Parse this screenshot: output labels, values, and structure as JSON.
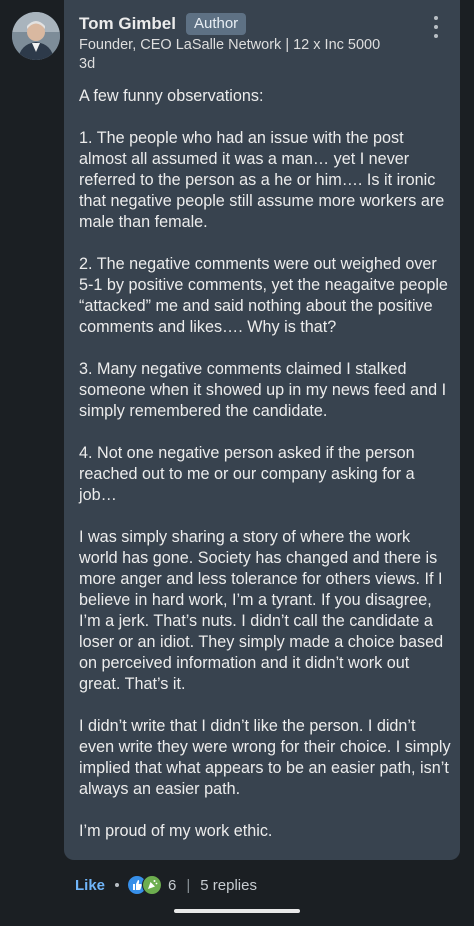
{
  "comment": {
    "author_name": "Tom Gimbel",
    "author_badge": "Author",
    "headline": "Founder, CEO LaSalle Network | 12 x Inc 5000",
    "timestamp": "3d",
    "paragraphs": [
      "A few funny observations:",
      "1. The people who had an issue with the post almost all assumed it was a man… yet I never referred to the person as a he or him…. Is it ironic that negative people still assume more workers are male than female.",
      "2. The negative comments were out weighed over 5-1 by positive comments, yet the neagaitve people “attacked” me and said nothing about the positive comments and likes…. Why is that?",
      "3. Many negative comments claimed I stalked someone when it showed up in my news feed and I simply remembered the candidate.",
      "4. Not one negative person asked if the person reached out to me or our company asking for a job…",
      "I was simply sharing a story of where the work world has gone. Society has changed and there is more anger and less tolerance for others views. If I believe in hard work, I’m a tyrant. If you disagree, I’m a jerk. That’s nuts. I didn’t call the candidate a loser or an idiot. They simply made a choice based on perceived information and it didn’t work out great. That’s it.",
      "I didn’t write that I didn’t like the person. I didn’t even write they were wrong for their choice. I simply implied that what appears to be an easier path, isn’t always an easier path.",
      "I’m proud of my work ethic."
    ]
  },
  "actions": {
    "like_label": "Like",
    "reaction_count": "6",
    "separator": "|",
    "replies_label": "5 replies"
  },
  "icons": {
    "more": "more-vertical-icon",
    "like_reaction": "thumbs-up-icon",
    "celebrate_reaction": "celebrate-icon"
  },
  "colors": {
    "background": "#1b1f23",
    "card": "#38434f",
    "badge": "#5e7184",
    "like": "#70b5f9",
    "like_reaction": "#378fe9",
    "celebrate_reaction": "#6dae4f"
  }
}
